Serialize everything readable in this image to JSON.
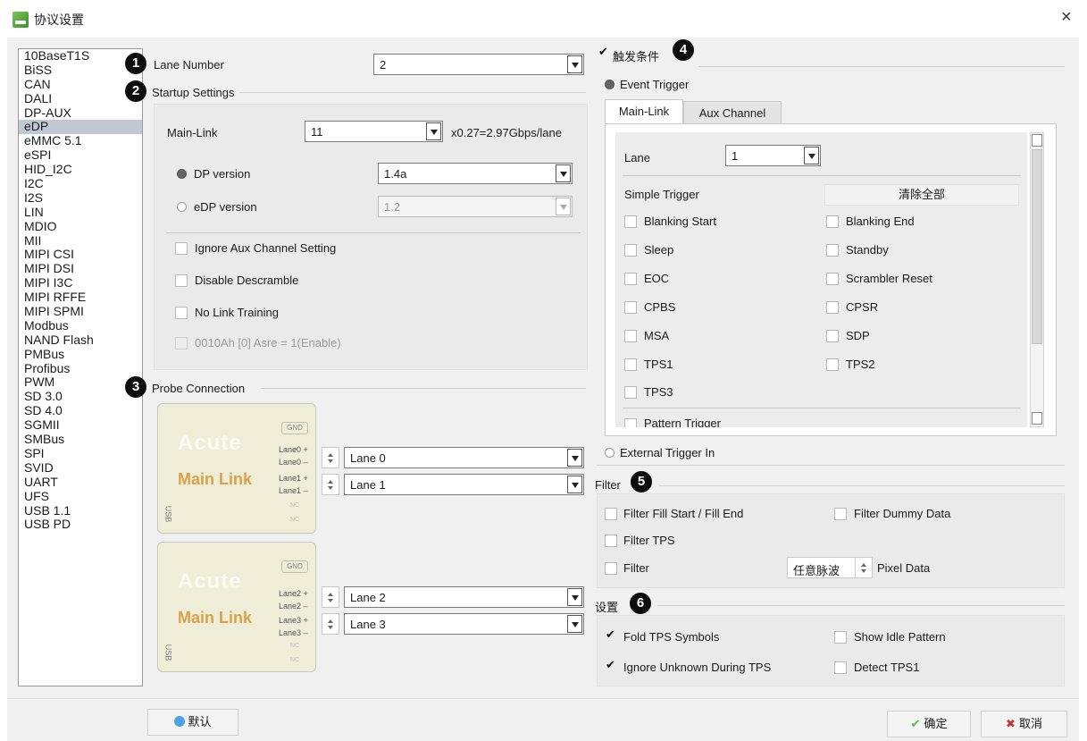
{
  "window": {
    "title": "协议设置",
    "close_glyph": "×"
  },
  "protocols": {
    "items": [
      "10BaseT1S",
      "BiSS",
      "CAN",
      "DALI",
      "DP-AUX",
      "eDP",
      "eMMC 5.1",
      "eSPI",
      "HID_I2C",
      "I2C",
      "I2S",
      "LIN",
      "MDIO",
      "MII",
      "MIPI CSI",
      "MIPI DSI",
      "MIPI I3C",
      "MIPI RFFE",
      "MIPI SPMI",
      "Modbus",
      "NAND Flash",
      "PMBus",
      "Profibus",
      "PWM",
      "SD 3.0",
      "SD 4.0",
      "SGMII",
      "SMBus",
      "SPI",
      "SVID",
      "UART",
      "UFS",
      "USB 1.1",
      "USB PD"
    ],
    "selected": "eDP"
  },
  "badges": [
    "1",
    "2",
    "3",
    "4",
    "5",
    "6"
  ],
  "lane_number": {
    "label": "Lane Number",
    "value": "2"
  },
  "startup": {
    "title": "Startup Settings",
    "main_link_label": "Main-Link",
    "main_link_value": "11",
    "main_link_rate": "x0.27=2.97Gbps/lane",
    "dp_version_label": "DP version",
    "dp_version_value": "1.4a",
    "edp_version_label": "eDP version",
    "edp_version_value": "1.2",
    "ignore_aux": "Ignore Aux Channel Setting",
    "disable_descramble": "Disable Descramble",
    "no_link_training": "No Link Training",
    "asre": "0010Ah [0]  Asre = 1(Enable)"
  },
  "probe": {
    "title": "Probe Connection",
    "card_brand": "Acute",
    "card_name": "Main Link",
    "gnd": "GND",
    "usb": "USB",
    "nc": "NC",
    "card1_pins": [
      "Lane0 +",
      "Lane0 –",
      "Lane1 +",
      "Lane1 –"
    ],
    "card2_pins": [
      "Lane2 +",
      "Lane2 –",
      "Lane3 +",
      "Lane3 –"
    ],
    "lanes": [
      "Lane 0",
      "Lane 1",
      "Lane 2",
      "Lane 3"
    ]
  },
  "trigger": {
    "title": "触发条件",
    "enabled": true,
    "event_trigger": "Event Trigger",
    "tabs": [
      "Main-Link",
      "Aux Channel"
    ],
    "active_tab": "Main-Link",
    "lane_label": "Lane",
    "lane_value": "1",
    "simple_trigger": "Simple Trigger",
    "clear_all": "清除全部",
    "left_items": [
      "Blanking Start",
      "Sleep",
      "EOC",
      "CPBS",
      "MSA",
      "TPS1",
      "TPS3"
    ],
    "right_items": [
      "Blanking End",
      "Standby",
      "Scrambler Reset",
      "CPSR",
      "SDP",
      "TPS2"
    ],
    "partial_item": "Pattern Trigger",
    "external_trigger": "External Trigger In"
  },
  "filter": {
    "title": "Filter",
    "fill": "Filter Fill Start / Fill End",
    "dummy": "Filter Dummy Data",
    "tps": "Filter TPS",
    "filter": "Filter",
    "pulse_value": "任意脉波",
    "pixel": "Pixel Data"
  },
  "settings": {
    "title": "设置",
    "fold_tps": "Fold TPS Symbols",
    "fold_tps_checked": true,
    "show_idle": "Show Idle Pattern",
    "ignore_unknown": "Ignore Unknown During TPS",
    "ignore_unknown_checked": true,
    "detect_tps1": "Detect TPS1"
  },
  "footer": {
    "default": "默认",
    "ok": "确定",
    "cancel": "取消",
    "ok_color": "#5cb85c",
    "cancel_color": "#c9302c"
  }
}
